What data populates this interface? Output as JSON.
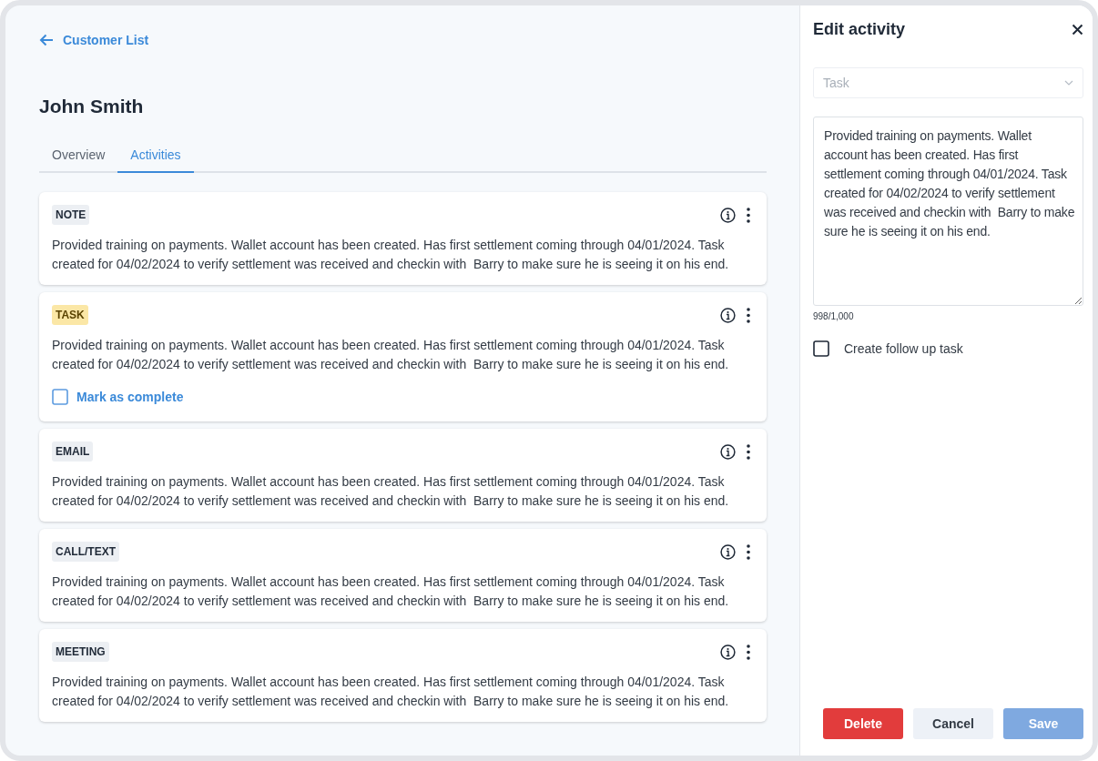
{
  "back_link": {
    "label": "Customer List"
  },
  "title": "John Smith",
  "tabs": [
    {
      "label": "Overview",
      "selected": false
    },
    {
      "label": "Activities",
      "selected": true
    }
  ],
  "activities": [
    {
      "kind": "note",
      "tag": "NOTE",
      "text": "Provided training on payments. Wallet account has been created. Has first settlement coming through 04/01/2024. Task created for 04/02/2024 to verify settlement was received and checkin with  Barry to make sure he is seeing it on his end."
    },
    {
      "kind": "task",
      "tag": "TASK",
      "text": "Provided training on payments. Wallet account has been created. Has first settlement coming through 04/01/2024. Task created for 04/02/2024 to verify settlement was received and checkin with  Barry to make sure he is seeing it on his end.",
      "complete_label": "Mark as complete",
      "checked": false
    },
    {
      "kind": "email",
      "tag": "EMAIL",
      "text": "Provided training on payments. Wallet account has been created. Has first settlement coming through 04/01/2024. Task created for 04/02/2024 to verify settlement was received and checkin with  Barry to make sure he is seeing it on his end."
    },
    {
      "kind": "call",
      "tag": "CALL/TEXT",
      "text": "Provided training on payments. Wallet account has been created. Has first settlement coming through 04/01/2024. Task created for 04/02/2024 to verify settlement was received and checkin with  Barry to make sure he is seeing it on his end."
    },
    {
      "kind": "meeting",
      "tag": "MEETING",
      "text": "Provided training on payments. Wallet account has been created. Has first settlement coming through 04/01/2024. Task created for 04/02/2024 to verify settlement was received and checkin with  Barry to make sure he is seeing it on his end."
    }
  ],
  "edit_panel": {
    "title": "Edit activity",
    "type_select": {
      "value": "Task",
      "disabled": true
    },
    "description": {
      "value": "Provided training on payments. Wallet account has been created. Has first settlement coming through 04/01/2024. Task created for 04/02/2024 to verify settlement was received and checkin with  Barry to make sure he is seeing it on his end."
    },
    "counter": "998/1,000",
    "follow_up": {
      "label": "Create follow up task",
      "checked": false
    },
    "buttons": [
      {
        "kind": "danger",
        "label": "Delete",
        "disabled": false
      },
      {
        "kind": "secondary",
        "label": "Cancel",
        "disabled": false
      },
      {
        "kind": "primary",
        "label": "Save",
        "disabled": true
      }
    ]
  }
}
